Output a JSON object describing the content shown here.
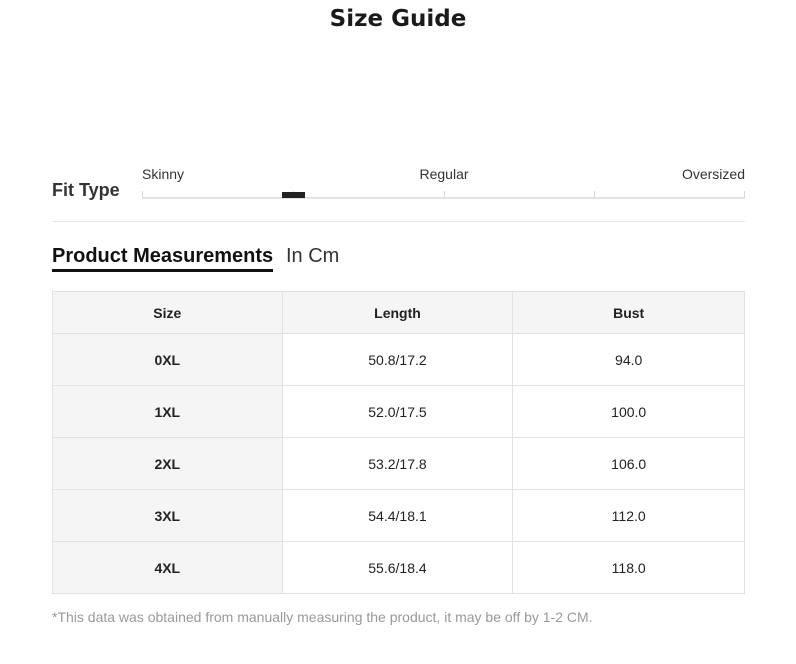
{
  "title": "Size Guide",
  "fit_type": {
    "label": "Fit Type",
    "scale_labels": [
      "Skinny",
      "Regular",
      "Oversized"
    ],
    "selected_position": 0.25
  },
  "measurements": {
    "heading": "Product Measurements",
    "unit": "In Cm",
    "columns": [
      "Size",
      "Length",
      "Bust"
    ],
    "rows": [
      [
        "0XL",
        "50.8/17.2",
        "94.0"
      ],
      [
        "1XL",
        "52.0/17.5",
        "100.0"
      ],
      [
        "2XL",
        "53.2/17.8",
        "106.0"
      ],
      [
        "3XL",
        "54.4/18.1",
        "112.0"
      ],
      [
        "4XL",
        "55.6/18.4",
        "118.0"
      ]
    ]
  },
  "note": "*This data was obtained from manually measuring the product, it may be off by 1-2 CM."
}
